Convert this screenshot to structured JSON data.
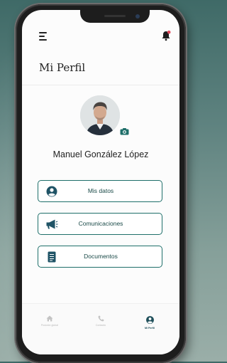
{
  "header": {
    "title": "Mi Perfil"
  },
  "icons": {
    "menu": "menu-icon",
    "notification": "bell-icon",
    "camera": "camera-icon"
  },
  "user": {
    "name": "Manuel González López"
  },
  "actions": [
    {
      "label": "Mis datos",
      "icon": "user-circle-icon"
    },
    {
      "label": "Comunicaciones",
      "icon": "megaphone-icon"
    },
    {
      "label": "Documentos",
      "icon": "document-icon"
    }
  ],
  "tabs": [
    {
      "label": "Posición global",
      "icon": "home-icon",
      "active": false
    },
    {
      "label": "Contacto",
      "icon": "phone-icon",
      "active": false
    },
    {
      "label": "Mi Perfil",
      "icon": "user-circle-icon",
      "active": true
    }
  ],
  "colors": {
    "accent": "#1f6f6a",
    "notification_dot": "#e0485a",
    "active_tab": "#1f4f5a"
  }
}
